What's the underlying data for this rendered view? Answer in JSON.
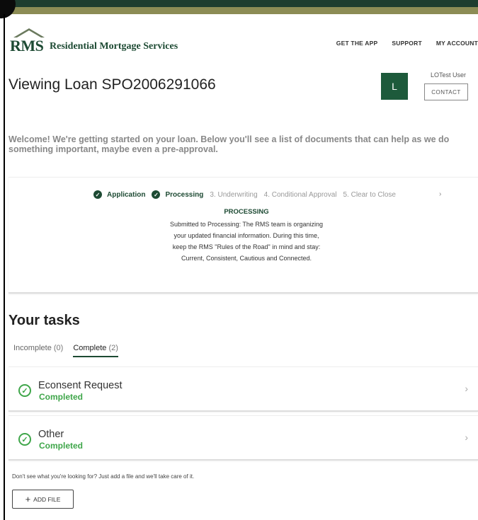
{
  "brand": {
    "logo_letters": "RMS",
    "name": "Residential Mortgage Services",
    "primary_color": "#1d4a33",
    "accent_color": "#8c8c55",
    "success_color": "#3fa64a"
  },
  "nav": {
    "items": [
      "GET THE APP",
      "SUPPORT",
      "MY ACCOUNT"
    ]
  },
  "page": {
    "title": "Viewing Loan SPO2006291066",
    "welcome": "Welcome! We're getting started on your loan. Below you'll see a list of documents that can help as we do something important, maybe even a pre-approval."
  },
  "user": {
    "initial": "L",
    "name": "LOTest User",
    "contact_label": "CONTACT"
  },
  "progress": {
    "steps": [
      {
        "label": "Application",
        "state": "done"
      },
      {
        "label": "Processing",
        "state": "done"
      },
      {
        "label": "3. Underwriting",
        "state": "future"
      },
      {
        "label": "4. Conditional Approval",
        "state": "future"
      },
      {
        "label": "5. Clear to Close",
        "state": "future"
      }
    ],
    "next_icon": "chevron-right-icon",
    "current_heading": "PROCESSING",
    "current_description": "Submitted to Processing: The RMS team is organizing your updated financial information. During this time, keep the RMS \"Rules of the Road\" in mind and stay: Current, Consistent, Cautious and Connected."
  },
  "tasks": {
    "heading": "Your tasks",
    "tabs": [
      {
        "label": "Incomplete",
        "count": "(0)",
        "active": false
      },
      {
        "label": "Complete",
        "count": "(2)",
        "active": true
      }
    ],
    "items": [
      {
        "title": "Econsent Request",
        "status": "Completed"
      },
      {
        "title": "Other",
        "status": "Completed"
      }
    ]
  },
  "footer": {
    "helper_text": "Don't see what you're looking for? Just add a file and we'll take care of it.",
    "add_file_label": "ADD FILE"
  }
}
